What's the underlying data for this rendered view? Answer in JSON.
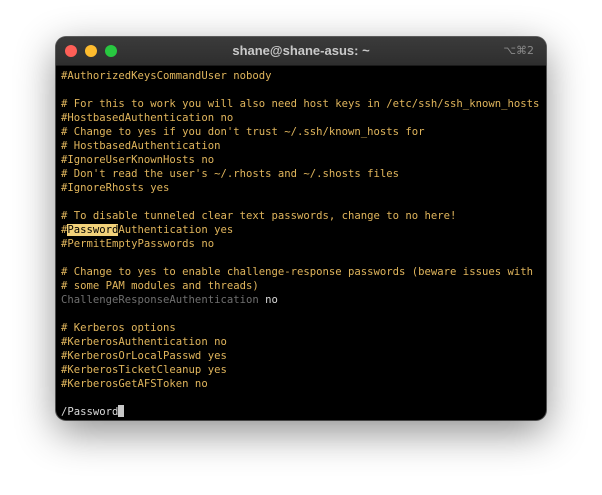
{
  "window": {
    "title": "shane@shane-asus: ~",
    "shortcut": "⌥⌘2"
  },
  "terminal": {
    "lines": [
      "#AuthorizedKeysCommandUser nobody",
      "",
      "# For this to work you will also need host keys in /etc/ssh/ssh_known_hosts",
      "#HostbasedAuthentication no",
      "# Change to yes if you don't trust ~/.ssh/known_hosts for",
      "# HostbasedAuthentication",
      "#IgnoreUserKnownHosts no",
      "# Don't read the user's ~/.rhosts and ~/.shosts files",
      "#IgnoreRhosts yes",
      "",
      "# To disable tunneled clear text passwords, change to no here!",
      "",
      "#PermitEmptyPasswords no",
      "",
      "# Change to yes to enable challenge-response passwords (beware issues with",
      "# some PAM modules and threads)",
      "",
      "",
      "# Kerberos options",
      "#KerberosAuthentication no",
      "#KerberosOrLocalPasswd yes",
      "#KerberosTicketCleanup yes",
      "#KerberosGetAFSToken no",
      "",
      ""
    ],
    "match_line": {
      "prefix": "#",
      "match": "Password",
      "suffix": "Authentication yes"
    },
    "challenge_line": {
      "key": "ChallengeResponseAuthentication",
      "value": " no"
    },
    "search_prompt": "/Password"
  }
}
